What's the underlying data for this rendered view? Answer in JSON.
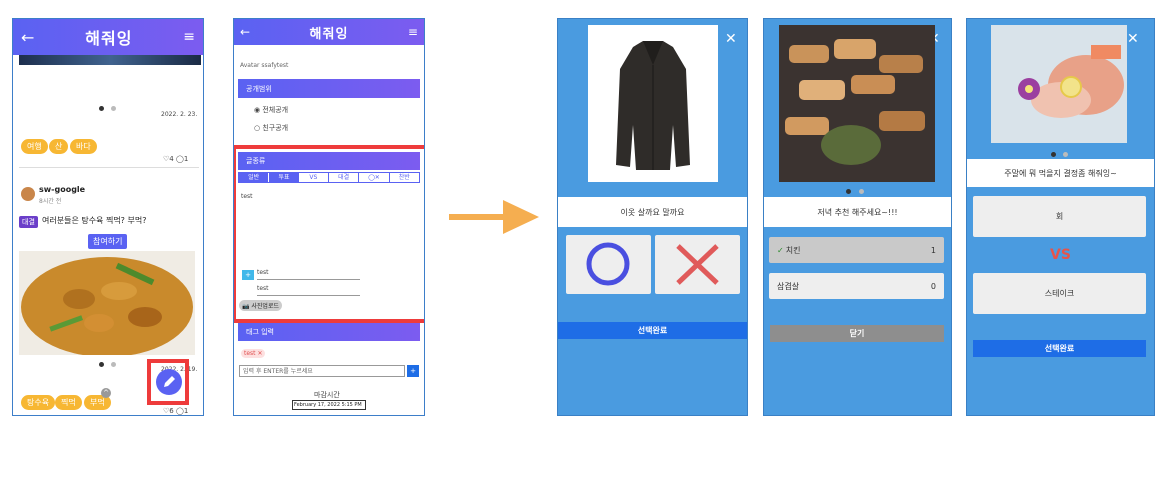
{
  "app": {
    "title": "해줘잉"
  },
  "screen1": {
    "post1_date": "2022. 2. 23.",
    "tags1": [
      "여행",
      "산",
      "바다"
    ],
    "likes1": "4",
    "comments1": "1",
    "username": "sw-google",
    "time": "8시간 전",
    "badge": "대결",
    "question": "여러분들은 탕수육 찍먹? 부먹?",
    "join_button": "참여하기",
    "post2_date": "2022. 2. 19.",
    "tags2": [
      "탕수육",
      "찍먹",
      "부먹"
    ],
    "likes2": "6",
    "comments2": "1"
  },
  "screen2": {
    "avatar_alt": "Avatar ssafytest",
    "visibility_title": "공개범위",
    "opt_all": "전체공개",
    "opt_friends": "친구공개",
    "type_title": "글종류",
    "type_tabs": [
      "일반",
      "투표",
      "VS",
      "대결",
      "◯✕",
      "찬반"
    ],
    "body_text": "test",
    "vote_items": [
      "test",
      "test"
    ],
    "add_button": "+",
    "photo_upload": "사진업로드",
    "tag_title": "태그 입력",
    "tag_chip": "test",
    "tag_placeholder": "입력 후 ENTER를 누르세요",
    "deadline_label": "마감시간",
    "deadline_value": "February 17, 2022 5:15 PM"
  },
  "result1": {
    "question": "이옷 살까요 말까요",
    "submit": "선택완료"
  },
  "result2": {
    "question": "저녁 추천 해주세요~!!!",
    "options": [
      {
        "label": "치킨",
        "count": "1"
      },
      {
        "label": "삼겹살",
        "count": "0"
      }
    ],
    "close": "닫기"
  },
  "result3": {
    "question": "주말에 뭐 먹을지 결정좀 해줘잉~",
    "option_a": "회",
    "vs": "VS",
    "option_b": "스테이크",
    "submit": "선택완료"
  },
  "colors": {
    "accent": "#5a62f2",
    "highlight_border": "#ee3b3b",
    "panel_blue": "#4a9be0",
    "arrow": "#f5ae50"
  }
}
